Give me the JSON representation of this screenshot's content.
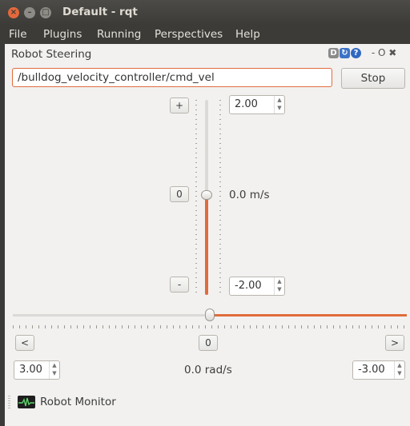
{
  "window": {
    "title": "Default - rqt"
  },
  "menu": {
    "items": [
      {
        "label": "File"
      },
      {
        "label": "Plugins"
      },
      {
        "label": "Running"
      },
      {
        "label": "Perspectives"
      },
      {
        "label": "Help"
      }
    ]
  },
  "dock": {
    "title": "Robot Steering",
    "controls": "- O ✖"
  },
  "steering": {
    "topic": "/bulldog_velocity_controller/cmd_vel",
    "stop_label": "Stop",
    "linear": {
      "increase_label": "+",
      "reset_label": "0",
      "decrease_label": "-",
      "max": "2.00",
      "min": "-2.00",
      "value": "0.0 m/s",
      "level": 0.0
    },
    "angular": {
      "left_label": "<",
      "reset_label": "0",
      "right_label": ">",
      "max": "3.00",
      "min": "-3.00",
      "value": "0.0 rad/s",
      "level": 0.0
    }
  },
  "monitor": {
    "label": "Robot Monitor"
  },
  "colors": {
    "accent": "#e06c3c",
    "titlebar": "#3c3b37",
    "panel": "#f2f1f0"
  }
}
